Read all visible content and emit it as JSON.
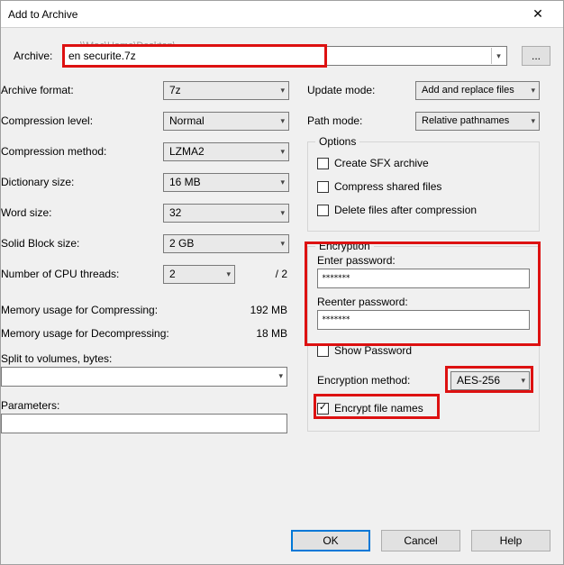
{
  "window": {
    "title": "Add to Archive"
  },
  "path_hint": "\\\\Mac\\Home\\Desktop\\",
  "archive": {
    "label": "Archive:",
    "value": "en securite.7z",
    "browse": "..."
  },
  "left": {
    "format": {
      "label": "Archive format:",
      "value": "7z"
    },
    "level": {
      "label": "Compression level:",
      "value": "Normal"
    },
    "method": {
      "label": "Compression method:",
      "value": "LZMA2"
    },
    "dict": {
      "label": "Dictionary size:",
      "value": "16 MB"
    },
    "word": {
      "label": "Word size:",
      "value": "32"
    },
    "block": {
      "label": "Solid Block size:",
      "value": "2 GB"
    },
    "cpu": {
      "label": "Number of CPU threads:",
      "value": "2",
      "max": "/ 2"
    },
    "mem_comp": {
      "label": "Memory usage for Compressing:",
      "value": "192 MB"
    },
    "mem_decomp": {
      "label": "Memory usage for Decompressing:",
      "value": "18 MB"
    },
    "split": {
      "label": "Split to volumes, bytes:",
      "value": ""
    },
    "params": {
      "label": "Parameters:",
      "value": ""
    }
  },
  "right": {
    "update": {
      "label": "Update mode:",
      "value": "Add and replace files"
    },
    "path": {
      "label": "Path mode:",
      "value": "Relative pathnames"
    },
    "options": {
      "legend": "Options",
      "sfx": "Create SFX archive",
      "shared": "Compress shared files",
      "delete": "Delete files after compression"
    },
    "enc": {
      "legend": "Encryption",
      "enter": "Enter password:",
      "reenter": "Reenter password:",
      "pwd_mask": "*******",
      "show": "Show Password",
      "method_label": "Encryption method:",
      "method_value": "AES-256",
      "names": "Encrypt file names"
    }
  },
  "buttons": {
    "ok": "OK",
    "cancel": "Cancel",
    "help": "Help"
  }
}
